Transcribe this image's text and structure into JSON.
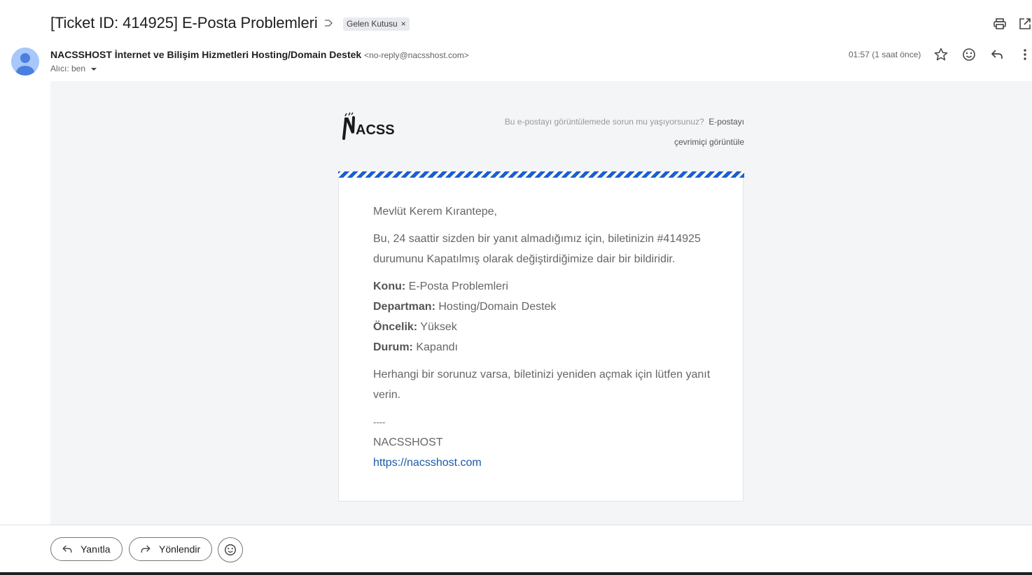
{
  "email": {
    "subject": "[Ticket ID: 414925] E-Posta Problemleri",
    "label_chip": "Gelen Kutusu",
    "label_remove": "×",
    "sender_name": "NACSSHOST İnternet ve Bilişim Hizmetleri Hosting/Domain Destek",
    "sender_email": "<no-reply@nacsshost.com>",
    "recipient": "Alıcı: ben",
    "time": "01:57 (1 saat önce)"
  },
  "body": {
    "logo_text": "ACSS",
    "logo_initial": "N",
    "view_problem": "Bu e-postayı görüntülemede sorun mu yaşıyorsunuz?",
    "view_online_1": "E-postayı",
    "view_online_2": "çevrimiçi görüntüle",
    "greeting": "Mevlüt Kerem Kırantepe,",
    "intro": "Bu, 24 saattir sizden bir yanıt almadığımız için, biletinizin #414925 durumunu Kapatılmış olarak değiştirdiğimize dair bir bildiridir.",
    "subject_label": "Konu:",
    "subject_value": "E-Posta Problemleri",
    "department_label": "Departman:",
    "department_value": "Hosting/Domain Destek",
    "priority_label": "Öncelik:",
    "priority_value": "Yüksek",
    "status_label": "Durum:",
    "status_value": "Kapandı",
    "reopen_note": "Herhangi bir sorunuz varsa, biletinizi yeniden açmak için lütfen yanıt verin.",
    "separator": "----",
    "signature": "NACSSHOST",
    "website": "https://nacsshost.com"
  },
  "actions": {
    "reply": "Yanıtla",
    "forward": "Yönlendir"
  },
  "icons": {
    "label": "label-arrow-icon",
    "print": "print-icon",
    "open_new": "open-in-new-icon",
    "star": "star-icon",
    "emoji": "emoji-icon",
    "reply": "reply-icon",
    "more": "more-vert-icon",
    "forward": "forward-icon",
    "dropdown": "caret-down-icon"
  },
  "colors": {
    "accent_stripe": "#1a5fd1",
    "link": "#1a5aa8",
    "body_bg": "#f4f5f7"
  }
}
